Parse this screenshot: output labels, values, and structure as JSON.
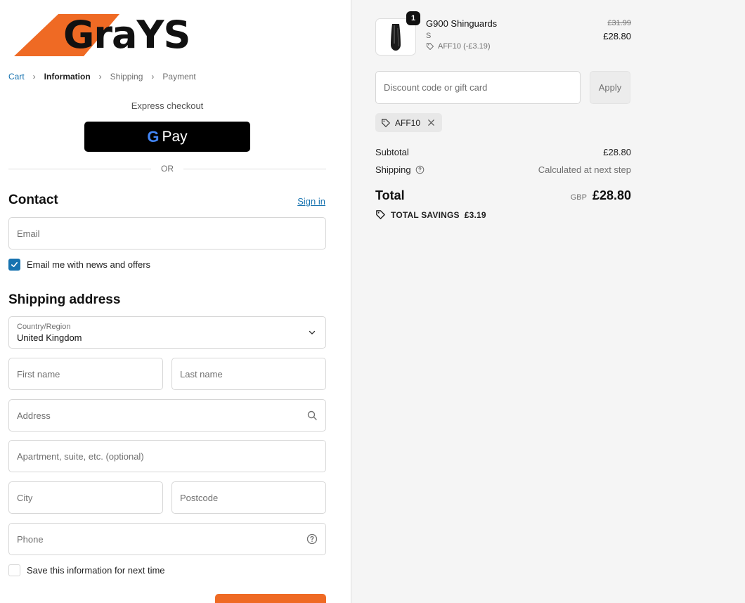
{
  "brand": {
    "name": "GraYS",
    "accent": "#ef6a24"
  },
  "breadcrumb": {
    "items": [
      "Cart",
      "Information",
      "Shipping",
      "Payment"
    ]
  },
  "express": {
    "title": "Express checkout",
    "gpay_g": "G",
    "gpay_label": "Pay",
    "divider": "OR"
  },
  "contact": {
    "title": "Contact",
    "sign_in": "Sign in",
    "email_placeholder": "Email",
    "newsletter_label": "Email me with news and offers",
    "newsletter_checked": true
  },
  "shipping": {
    "title": "Shipping address",
    "country_label": "Country/Region",
    "country_value": "United Kingdom",
    "first_name": "First name",
    "last_name": "Last name",
    "address": "Address",
    "apartment": "Apartment, suite, etc. (optional)",
    "city": "City",
    "postcode": "Postcode",
    "phone": "Phone",
    "save_label": "Save this information for next time",
    "save_checked": false
  },
  "summary": {
    "item": {
      "quantity": "1",
      "name": "G900 Shinguards",
      "variant": "S",
      "discount": "AFF10 (-£3.19)",
      "old_price": "£31.99",
      "price": "£28.80"
    },
    "discount_placeholder": "Discount code or gift card",
    "apply_label": "Apply",
    "applied_code": "AFF10",
    "subtotal_label": "Subtotal",
    "subtotal_value": "£28.80",
    "shipping_label": "Shipping",
    "shipping_value": "Calculated at next step",
    "total_label": "Total",
    "currency": "GBP",
    "total_value": "£28.80",
    "savings_label": "TOTAL SAVINGS",
    "savings_value": "£3.19"
  }
}
